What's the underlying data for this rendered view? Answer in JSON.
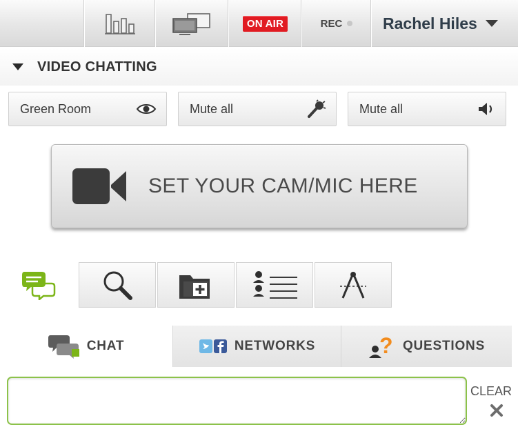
{
  "topbar": {
    "stats_icon": "bar-chart-icon",
    "screens_icon": "screen-share-icon",
    "onair_label": "ON AIR",
    "rec_label": "REC",
    "user_name": "Rachel Hiles",
    "onair_color": "#e11b22"
  },
  "section": {
    "title": "VIDEO CHATTING"
  },
  "controls": {
    "green_room_label": "Green Room",
    "mute_mics_label": "Mute all",
    "mute_speakers_label": "Mute all"
  },
  "cam": {
    "label": "SET YOUR CAM/MIC HERE"
  },
  "tools": {
    "icons": [
      "chat-bubbles-icon",
      "search-icon",
      "add-folder-icon",
      "user-list-icon",
      "compass-tool-icon"
    ],
    "accent_color": "#7cb518"
  },
  "chat_tabs": {
    "chat_label": "CHAT",
    "networks_label": "NETWORKS",
    "questions_label": "QUESTIONS"
  },
  "chat_input": {
    "value": "",
    "placeholder": "",
    "clear_label": "CLEAR"
  }
}
